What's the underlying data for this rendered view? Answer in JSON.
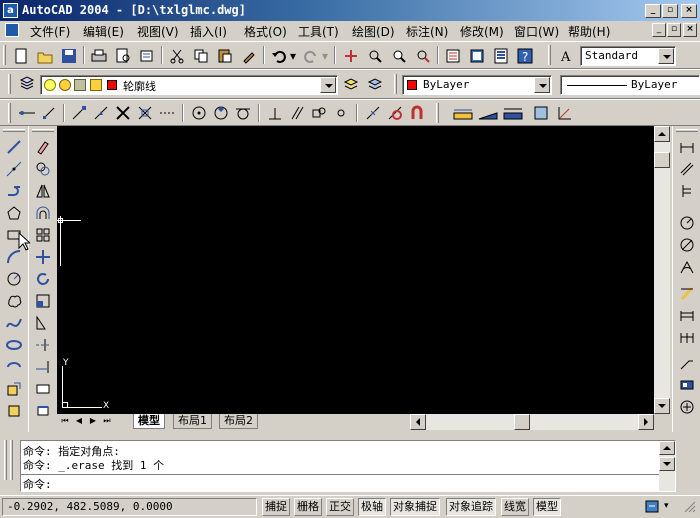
{
  "window": {
    "title": "AutoCAD 2004 - [D:\\txlglmc.dwg]",
    "controls": {
      "minimize": "_",
      "restore": "▫",
      "close": "×"
    }
  },
  "menu": [
    "文件(F)",
    "编辑(E)",
    "视图(V)",
    "插入(I)",
    "格式(O)",
    "工具(T)",
    "绘图(D)",
    "标注(N)",
    "修改(M)",
    "窗口(W)",
    "帮助(H)"
  ],
  "toolbar": {
    "text_style": "Standard",
    "layer": "轮廓线",
    "color": "ByLayer",
    "color_swatch": "#ff0000",
    "linetype": "ByLayer"
  },
  "canvas": {
    "ucs_x": "X",
    "ucs_y": "Y",
    "background": "#000000"
  },
  "tabs": [
    "模型",
    "布局1",
    "布局2"
  ],
  "command": {
    "lines": [
      "命令: 指定对角点:",
      "命令: _.erase 找到 1 个"
    ],
    "prompt": "命令:"
  },
  "status": {
    "coords": "-0.2902, 482.5089, 0.0000",
    "buttons": [
      {
        "label": "捕捉",
        "on": false
      },
      {
        "label": "栅格",
        "on": false
      },
      {
        "label": "正交",
        "on": false
      },
      {
        "label": "极轴",
        "on": true
      },
      {
        "label": "对象捕捉",
        "on": true
      },
      {
        "label": "对象追踪",
        "on": true
      },
      {
        "label": "线宽",
        "on": false
      },
      {
        "label": "模型",
        "on": true
      }
    ]
  }
}
